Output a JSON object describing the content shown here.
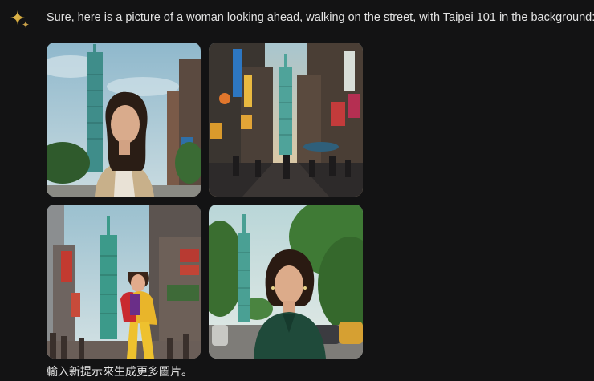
{
  "assistant": {
    "logo_icon": "sparkle-icon",
    "message": "Sure, here is a picture of a woman looking ahead, walking on the street, with Taipei 101 in the background:",
    "footer_prompt": "輸入新提示來生成更多圖片。"
  },
  "images": [
    {
      "name": "generated-image-1"
    },
    {
      "name": "generated-image-2"
    },
    {
      "name": "generated-image-3"
    },
    {
      "name": "generated-image-4"
    }
  ],
  "colors": {
    "background": "#131314",
    "text": "#e3e3e3",
    "sparkle_a": "#4f86f7",
    "sparkle_b": "#e8a735"
  }
}
